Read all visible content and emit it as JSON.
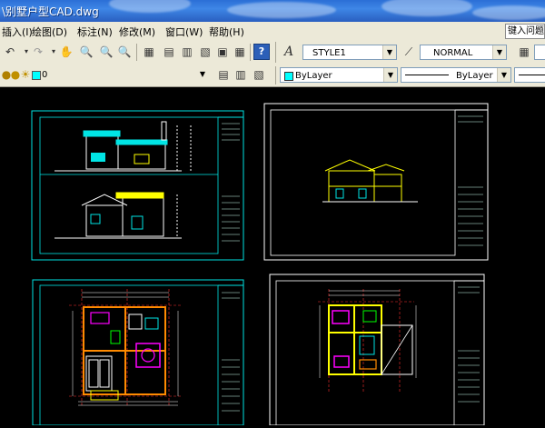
{
  "window": {
    "title": "\\别墅户型CAD.dwg"
  },
  "menu": {
    "items": [
      "插入(I)",
      "绘图(D)",
      "标注(N)",
      "修改(M)",
      "窗口(W)",
      "帮助(H)"
    ],
    "help_placeholder": "键入问题"
  },
  "toolbar": {
    "text_style": "STYLE1",
    "dim_style": "NORMAL",
    "layer": "0",
    "color": "ByLayer",
    "linetype": "ByLayer"
  },
  "colors": {
    "background": "#000000",
    "frame": "#00e5e5",
    "yellow": "#ffff00",
    "magenta": "#ff00ff",
    "orange": "#ff8a00",
    "white": "#ffffff",
    "green": "#00ff00",
    "red": "#ff3030"
  }
}
